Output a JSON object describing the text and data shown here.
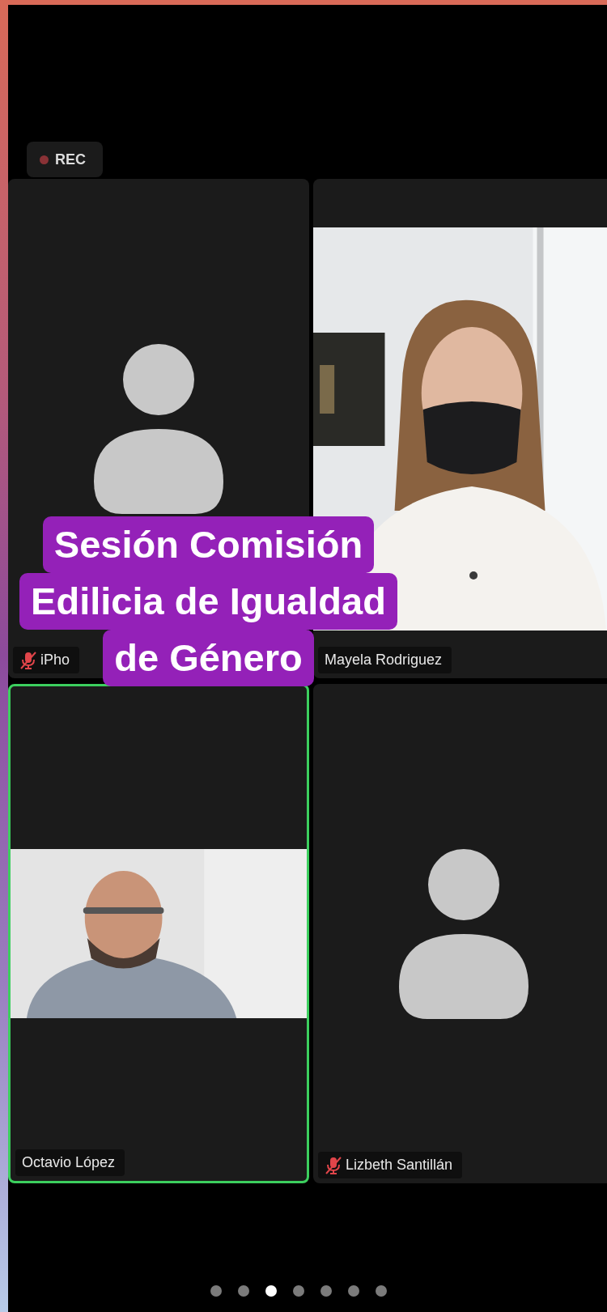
{
  "recording": {
    "label": "REC"
  },
  "tiles": [
    {
      "kind": "avatar",
      "name": "iPho",
      "muted": true,
      "speaking": false
    },
    {
      "kind": "picture",
      "name": "Mayela Rodriguez",
      "muted": false,
      "speaking": false
    },
    {
      "kind": "picture",
      "name": "Octavio López",
      "muted": false,
      "speaking": true
    },
    {
      "kind": "avatar",
      "name": "Lizbeth Santillán",
      "muted": true,
      "speaking": false
    }
  ],
  "caption": {
    "lines": [
      "Sesión Comisión",
      "Edilicia de Igualdad",
      "de Género"
    ]
  },
  "pages": [
    {
      "selected": false
    },
    {
      "selected": false
    },
    {
      "selected": true
    },
    {
      "selected": false
    },
    {
      "selected": false
    },
    {
      "selected": false
    },
    {
      "selected": false
    }
  ]
}
